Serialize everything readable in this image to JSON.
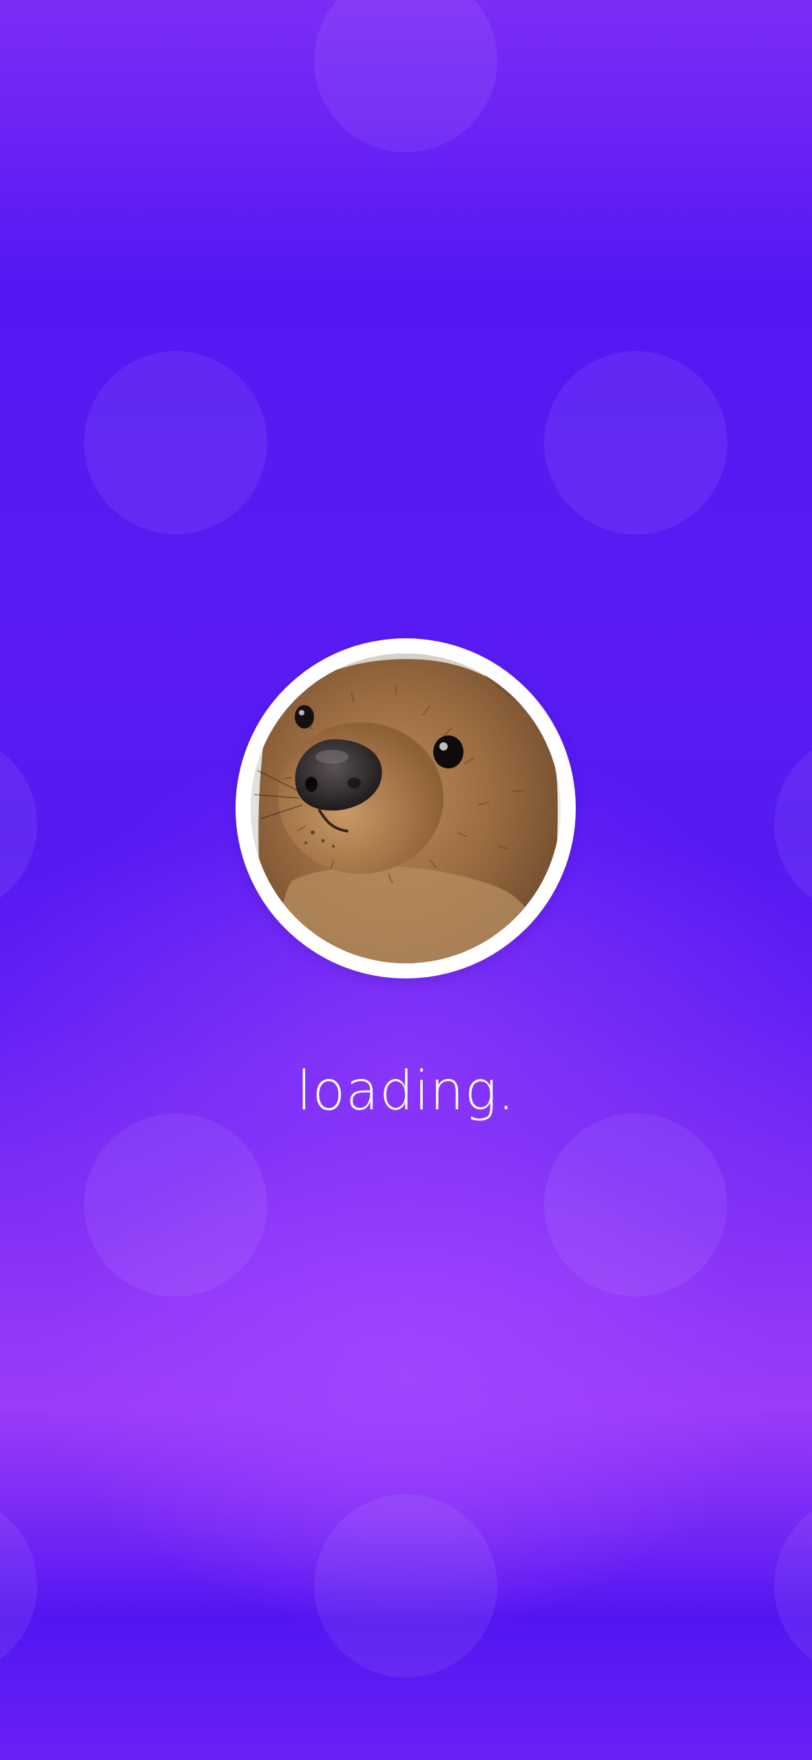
{
  "app": {
    "screen": "loading-splash"
  },
  "colors": {
    "background_top": "#7d2cf6",
    "background_mid": "#5418f3",
    "background_glow": "#9a3cf8",
    "ring": "#ffffff",
    "text": "#ffffff"
  },
  "avatar": {
    "subject": "quokka-photo"
  },
  "status": {
    "loading_label": "loading."
  }
}
